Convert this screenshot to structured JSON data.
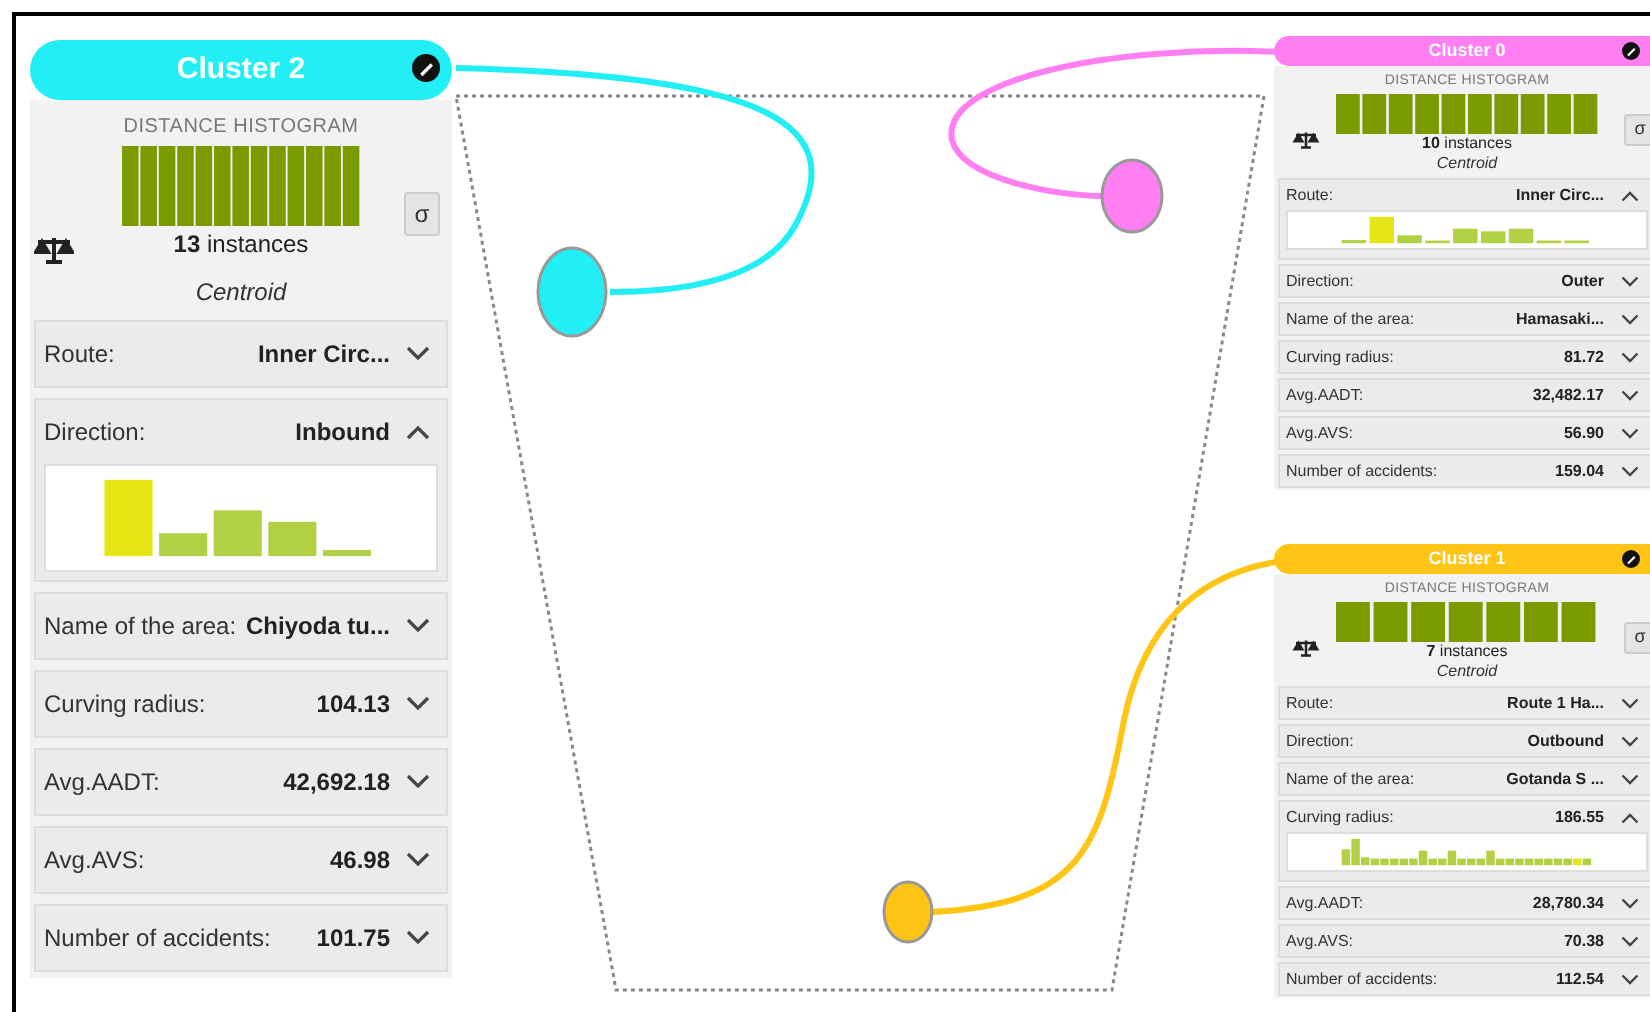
{
  "clusters": [
    {
      "title": "Cluster 2",
      "color": "#22eef5",
      "histogram_title": "DISTANCE HISTOGRAM",
      "instances_count": "13",
      "instances_label": "instances",
      "centroid": "Centroid",
      "sigma": "σ",
      "attributes": [
        {
          "label": "Route:",
          "value": "Inner Circ...",
          "expanded": false
        },
        {
          "label": "Direction:",
          "value": "Inbound",
          "expanded": true
        },
        {
          "label": "Name of the area:",
          "value": "Chiyoda tu...",
          "expanded": false
        },
        {
          "label": "Curving radius:",
          "value": "104.13",
          "expanded": false
        },
        {
          "label": "Avg.AADT:",
          "value": "42,692.18",
          "expanded": false
        },
        {
          "label": "Avg.AVS:",
          "value": "46.98",
          "expanded": false
        },
        {
          "label": "Number of accidents:",
          "value": "101.75",
          "expanded": false
        }
      ]
    },
    {
      "title": "Cluster 0",
      "color": "#ff7ff2",
      "histogram_title": "DISTANCE HISTOGRAM",
      "instances_count": "10",
      "instances_label": "instances",
      "centroid": "Centroid",
      "sigma": "σ",
      "attributes": [
        {
          "label": "Route:",
          "value": "Inner Circ...",
          "expanded": true
        },
        {
          "label": "Direction:",
          "value": "Outer",
          "expanded": false
        },
        {
          "label": "Name of the area:",
          "value": "Hamasaki...",
          "expanded": false
        },
        {
          "label": "Curving radius:",
          "value": "81.72",
          "expanded": false
        },
        {
          "label": "Avg.AADT:",
          "value": "32,482.17",
          "expanded": false
        },
        {
          "label": "Avg.AVS:",
          "value": "56.90",
          "expanded": false
        },
        {
          "label": "Number of accidents:",
          "value": "159.04",
          "expanded": false
        }
      ]
    },
    {
      "title": "Cluster 1",
      "color": "#ffc414",
      "histogram_title": "DISTANCE HISTOGRAM",
      "instances_count": "7",
      "instances_label": "instances",
      "centroid": "Centroid",
      "sigma": "σ",
      "attributes": [
        {
          "label": "Route:",
          "value": "Route 1 Ha...",
          "expanded": false
        },
        {
          "label": "Direction:",
          "value": "Outbound",
          "expanded": false
        },
        {
          "label": "Name of the area:",
          "value": "Gotanda S ...",
          "expanded": false
        },
        {
          "label": "Curving radius:",
          "value": "186.55",
          "expanded": true
        },
        {
          "label": "Avg.AADT:",
          "value": "28,780.34",
          "expanded": false
        },
        {
          "label": "Avg.AVS:",
          "value": "70.38",
          "expanded": false
        },
        {
          "label": "Number of accidents:",
          "value": "112.54",
          "expanded": false
        }
      ]
    }
  ]
}
